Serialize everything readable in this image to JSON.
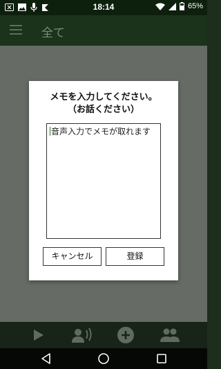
{
  "status_bar": {
    "time": "18:14",
    "battery": "65%",
    "left_icons": [
      "notification-x-icon",
      "image-icon",
      "mic-icon",
      "app-icon"
    ],
    "right_icons": [
      "wifi-icon",
      "signal-icon",
      "battery-icon"
    ]
  },
  "app_bar": {
    "menu_icon": "hamburger-icon",
    "title": "全て"
  },
  "dialog": {
    "title_line1": "メモを入力してください。",
    "title_line2": "（お話ください）",
    "memo_text": "音声入力でメモが取れます",
    "cancel_label": "キャンセル",
    "register_label": "登録"
  },
  "toolbar": {
    "items": [
      "play-icon",
      "voice-icon",
      "add-circle-icon",
      "people-icon"
    ]
  },
  "nav_bar": {
    "items": [
      "back-icon",
      "home-icon",
      "recent-apps-icon"
    ]
  },
  "colors": {
    "app_bar": "#1a331a",
    "status_bar": "#0d1f0d",
    "dim_background": "#666b66",
    "toolbar": "#182418",
    "nav_bar": "#050805"
  }
}
